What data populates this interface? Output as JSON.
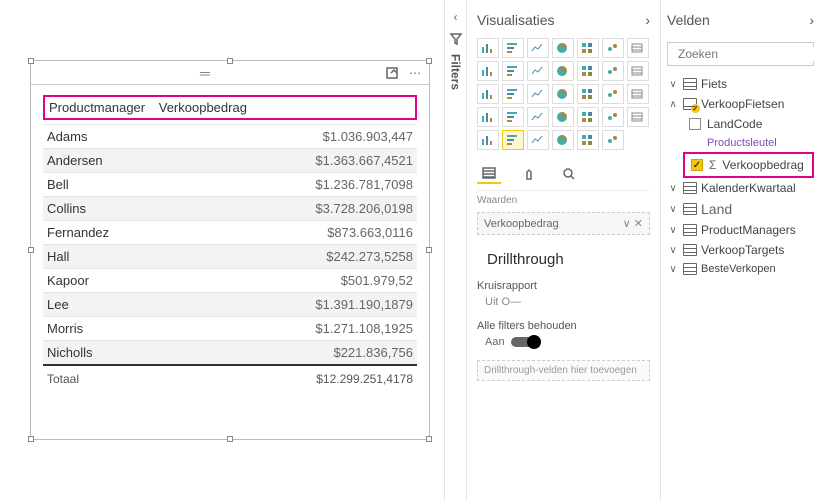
{
  "table": {
    "header_col1": "Productmanager",
    "header_col2": "Verkoopbedrag",
    "rows": [
      {
        "name": "Adams",
        "value": "$1.036.903,447"
      },
      {
        "name": "Andersen",
        "value": "$1.363.667,4521"
      },
      {
        "name": "Bell",
        "value": "$1.236.781,7098"
      },
      {
        "name": "Collins",
        "value": "$3.728.206,0198"
      },
      {
        "name": "Fernandez",
        "value": "$873.663,0116"
      },
      {
        "name": "Hall",
        "value": "$242.273,5258"
      },
      {
        "name": "Kapoor",
        "value": "$501.979,52"
      },
      {
        "name": "Lee",
        "value": "$1.391.190,1879"
      },
      {
        "name": "Morris",
        "value": "$1.271.108,1925"
      },
      {
        "name": "Nicholls",
        "value": "$221.836,756"
      }
    ],
    "total_label": "Totaal",
    "total_value": "$12.299.251,4178"
  },
  "filters": {
    "rail_label": "Filters"
  },
  "viz": {
    "title": "Visualisaties",
    "values_label": "Waarden",
    "well_field": "Verkoopbedrag",
    "drill_title": "Drillthrough",
    "cross_label": "Kruisrapport",
    "cross_state": "Uit",
    "keep_filters_label": "Alle filters behouden",
    "keep_filters_state": "Aan",
    "drill_well_placeholder": "Drillthrough-velden hier toevoegen"
  },
  "fields": {
    "title": "Velden",
    "search_placeholder": "Zoeken",
    "tables": {
      "fiets": "Fiets",
      "verkoopfietsen": "VerkoopFietsen",
      "landcode": "LandCode",
      "productsleutel": "Productsleutel",
      "verkoopbedrag_prefix": "Σ",
      "verkoopbedrag": "Verkoopbedrag",
      "kalender": "KalenderKwartaal",
      "land": "Land",
      "productmanagers": "ProductManagers",
      "verkooptargets": "VerkoopTargets",
      "besteverkopen": "BesteVerkopen"
    }
  }
}
